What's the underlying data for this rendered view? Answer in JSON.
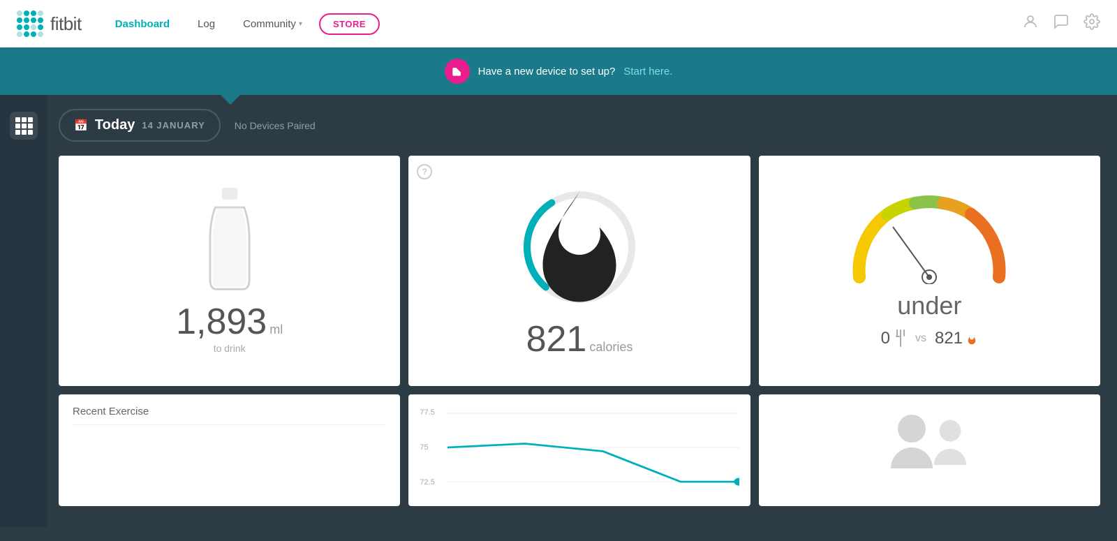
{
  "navbar": {
    "logo_text": "fitbit",
    "nav_items": [
      {
        "label": "Dashboard",
        "active": true
      },
      {
        "label": "Log",
        "active": false
      },
      {
        "label": "Community",
        "active": false,
        "has_dropdown": true
      },
      {
        "label": "STORE",
        "active": false,
        "is_store": true
      }
    ],
    "icons": [
      "person-icon",
      "message-icon",
      "settings-icon"
    ]
  },
  "notification_bar": {
    "icon": "🔗",
    "text": "Have a new device to set up?",
    "link_text": "Start here."
  },
  "date_bar": {
    "today_label": "Today",
    "date": "14 JANUARY",
    "device_status": "No Devices Paired"
  },
  "water_card": {
    "amount": "1,893",
    "unit": "ml",
    "label": "to drink"
  },
  "calories_card": {
    "amount": "821",
    "unit": "calories",
    "ring_percent": 0.3
  },
  "weight_card": {
    "status": "under",
    "food_calories": "0",
    "vs_label": "vs",
    "burned_calories": "821"
  },
  "chart_card": {
    "labels": [
      "77.5",
      "75",
      "72.5"
    ]
  },
  "bottom_left_card": {
    "title": "Recent Exercise"
  },
  "colors": {
    "teal": "#00b0b9",
    "dark_bg": "#2d3b45",
    "notification_bg": "#1a7a8a",
    "pink": "#e91e8c",
    "gauge_yellow": "#f5c800",
    "gauge_green": "#8bc34a",
    "gauge_orange": "#ff9800"
  }
}
